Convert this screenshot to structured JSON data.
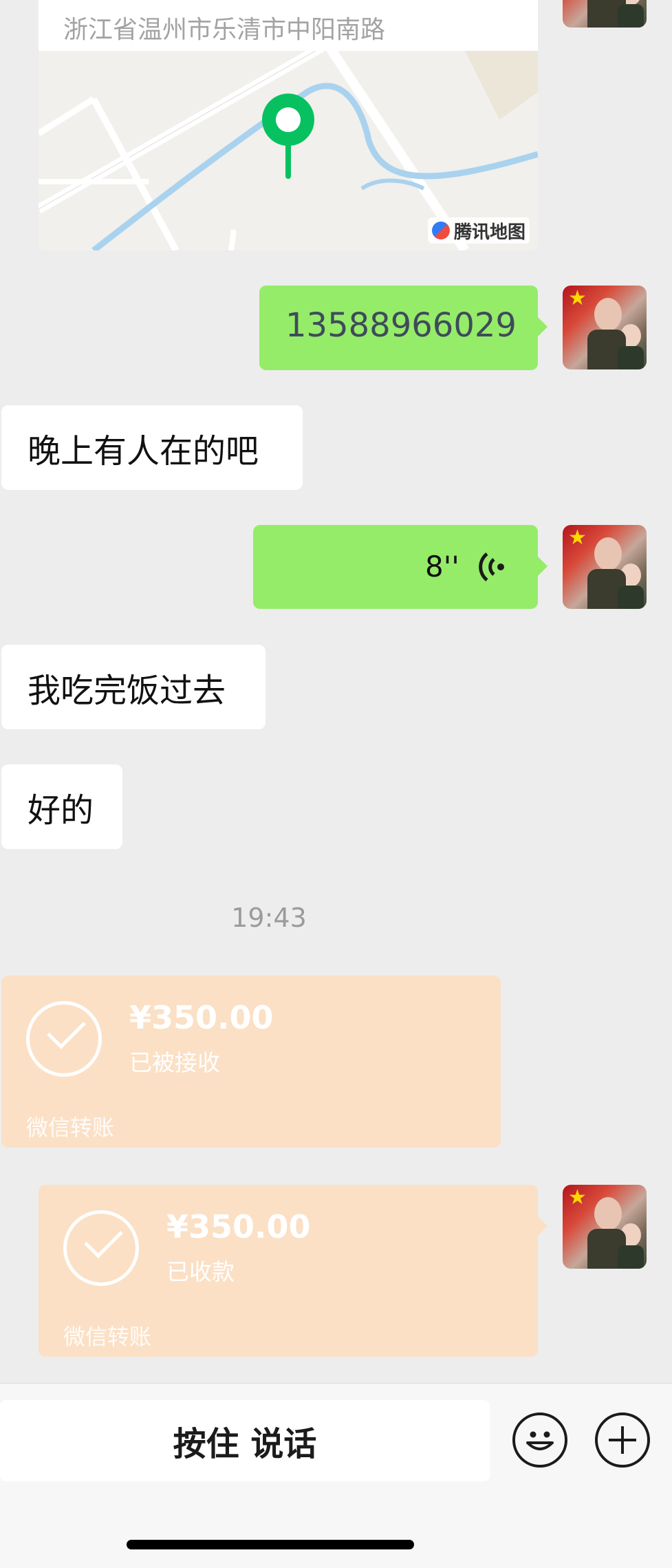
{
  "location_card": {
    "address": "浙江省温州市乐清市中阳南路",
    "map_provider": "腾讯地图"
  },
  "messages": [
    {
      "side": "right",
      "type": "text",
      "text": "13588966029"
    },
    {
      "side": "left",
      "type": "text",
      "text": "晚上有人在的吧"
    },
    {
      "side": "right",
      "type": "voice",
      "duration": "8''"
    },
    {
      "side": "left",
      "type": "text",
      "text": "我吃完饭过去"
    },
    {
      "side": "left",
      "type": "text",
      "text": "好的"
    }
  ],
  "timestamp": "19:43",
  "transfers": [
    {
      "side": "left",
      "amount": "¥350.00",
      "status": "已被接收",
      "brand": "微信转账"
    },
    {
      "side": "right",
      "amount": "¥350.00",
      "status": "已收款",
      "brand": "微信转账"
    }
  ],
  "input_bar": {
    "hold_to_talk": "按住 说话",
    "emoji_icon": "smiley-icon",
    "plus_icon": "plus-icon"
  },
  "colors": {
    "background": "#ededed",
    "sent_bubble": "#95ec69",
    "received_bubble": "#ffffff",
    "transfer_card": "#fbe0c5",
    "map_pin": "#07c160"
  }
}
